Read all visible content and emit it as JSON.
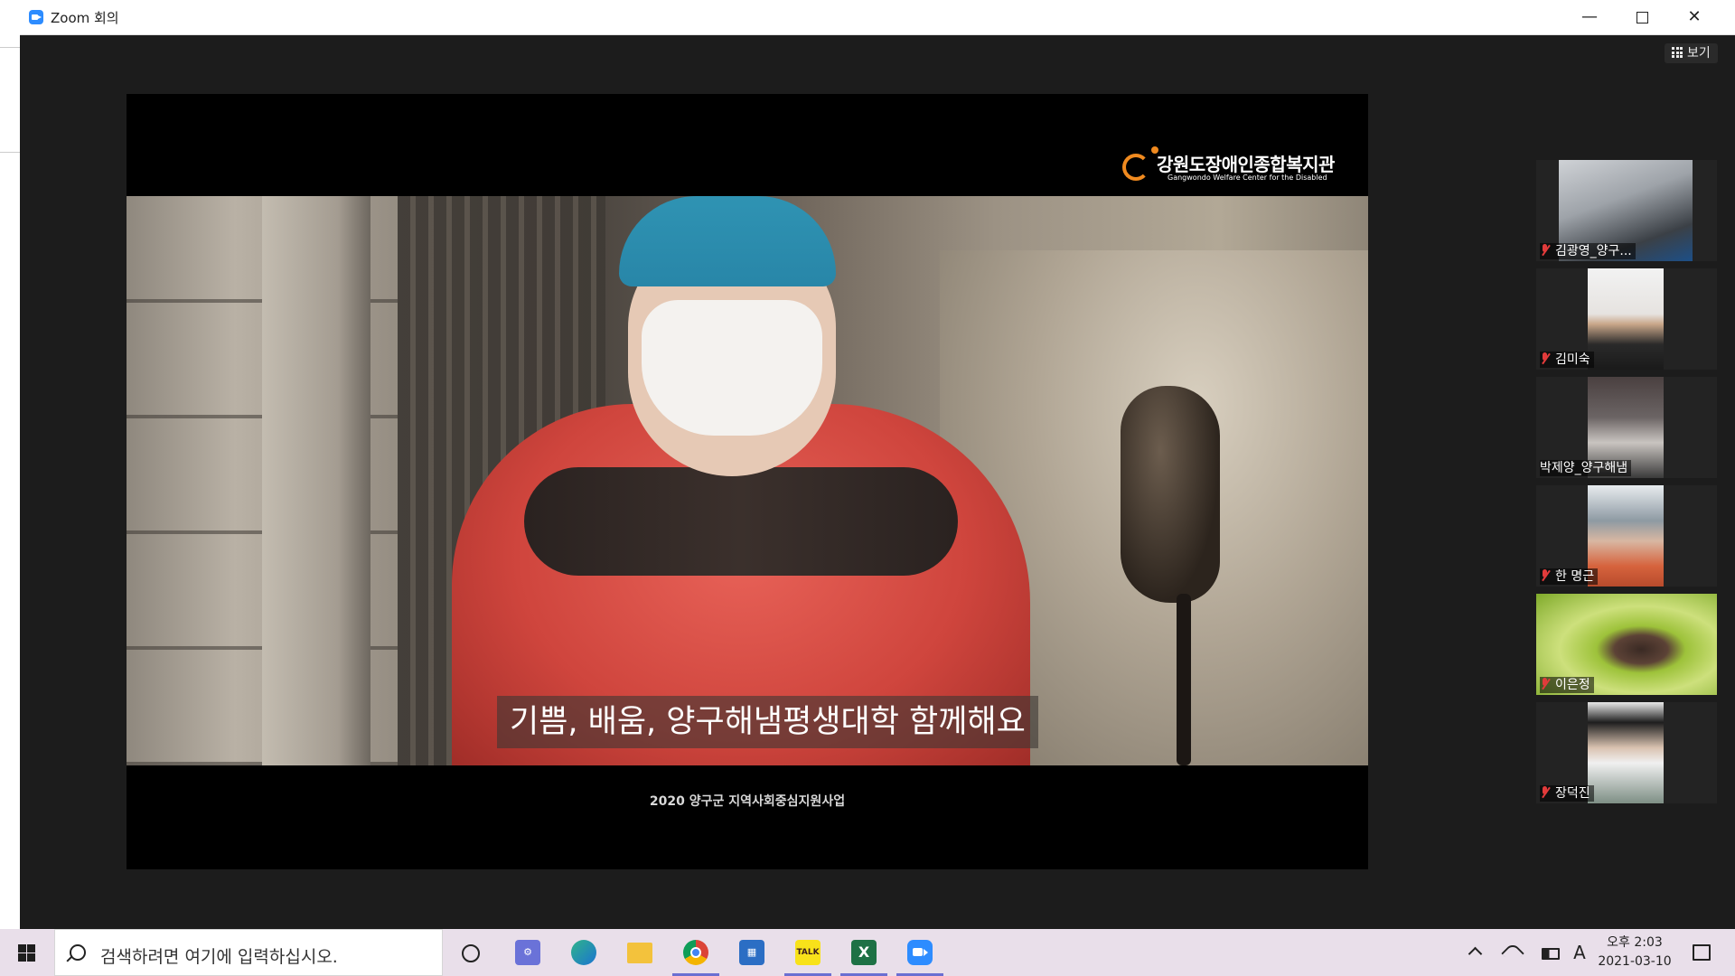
{
  "window": {
    "title": "Zoom 회의",
    "view_label": "보기",
    "minimize_icon": "minimize-icon",
    "maximize_icon": "maximize-icon",
    "close_icon": "close-icon"
  },
  "shared_screen": {
    "logo_korean": "강원도장애인종합복지관",
    "logo_english": "Gangwondo Welfare Center for the Disabled",
    "subtitle": "기쁨, 배움, 양구해냄평생대학 함께해요",
    "caption": "2020 양구군 지역사회중심지원사업"
  },
  "participants": [
    {
      "name": "김광영_양구...",
      "muted": true
    },
    {
      "name": "김미숙",
      "muted": true
    },
    {
      "name": "박제양_양구해냄",
      "muted": false
    },
    {
      "name": "한 명근",
      "muted": true
    },
    {
      "name": "이은정",
      "muted": true
    },
    {
      "name": "장덕진",
      "muted": true
    }
  ],
  "taskbar": {
    "search_placeholder": "검색하려면 여기에 입력하십시오.",
    "apps": [
      "settings",
      "edge",
      "file-explorer",
      "chrome",
      "outlook",
      "kakaotalk",
      "excel",
      "zoom"
    ],
    "kakao_label": "TALK",
    "excel_label": "X",
    "ime_label": "A",
    "clock_time": "오후 2:03",
    "clock_date": "2021-03-10"
  },
  "colors": {
    "zoom_blue": "#2d8cff",
    "muted_red": "#e23b3b",
    "window_bg": "#1c1c1c",
    "taskbar_bg": "#e9dfea"
  }
}
